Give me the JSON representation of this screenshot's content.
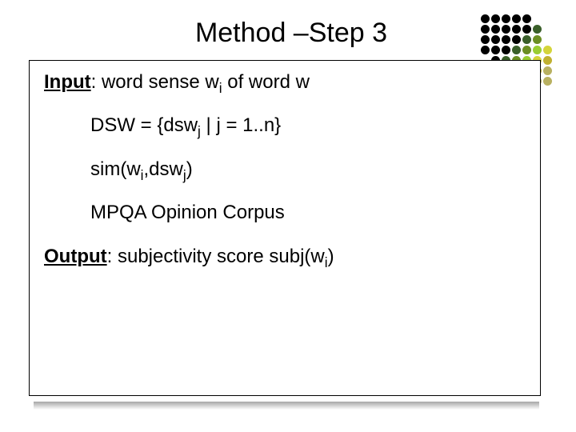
{
  "title": "Method –Step 3",
  "box": {
    "input": {
      "label": "Input",
      "text_before_sub": ": word sense w",
      "sub1": "i",
      "text_after_sub": " of word w"
    },
    "dsw": {
      "lead": "DSW = {dsw",
      "sub": "j",
      "tail": " | j = 1..n}"
    },
    "sim": {
      "lead": "sim(w",
      "sub1": "i",
      "mid": ",dsw",
      "sub2": "j",
      "tail": ")"
    },
    "mpqa": "MPQA Opinion Corpus",
    "output": {
      "label": "Output",
      "text_before": ": subjectivity score subj(w",
      "sub": "i",
      "text_after": ")"
    }
  },
  "deco_colors": {
    "black": "#000000",
    "dkgreen": "#3a5f2a",
    "olive": "#6b8e23",
    "yellowgreen": "#9acd32",
    "yellow": "#d4d43a",
    "gold": "#c0b030",
    "khaki": "#b8b060"
  }
}
